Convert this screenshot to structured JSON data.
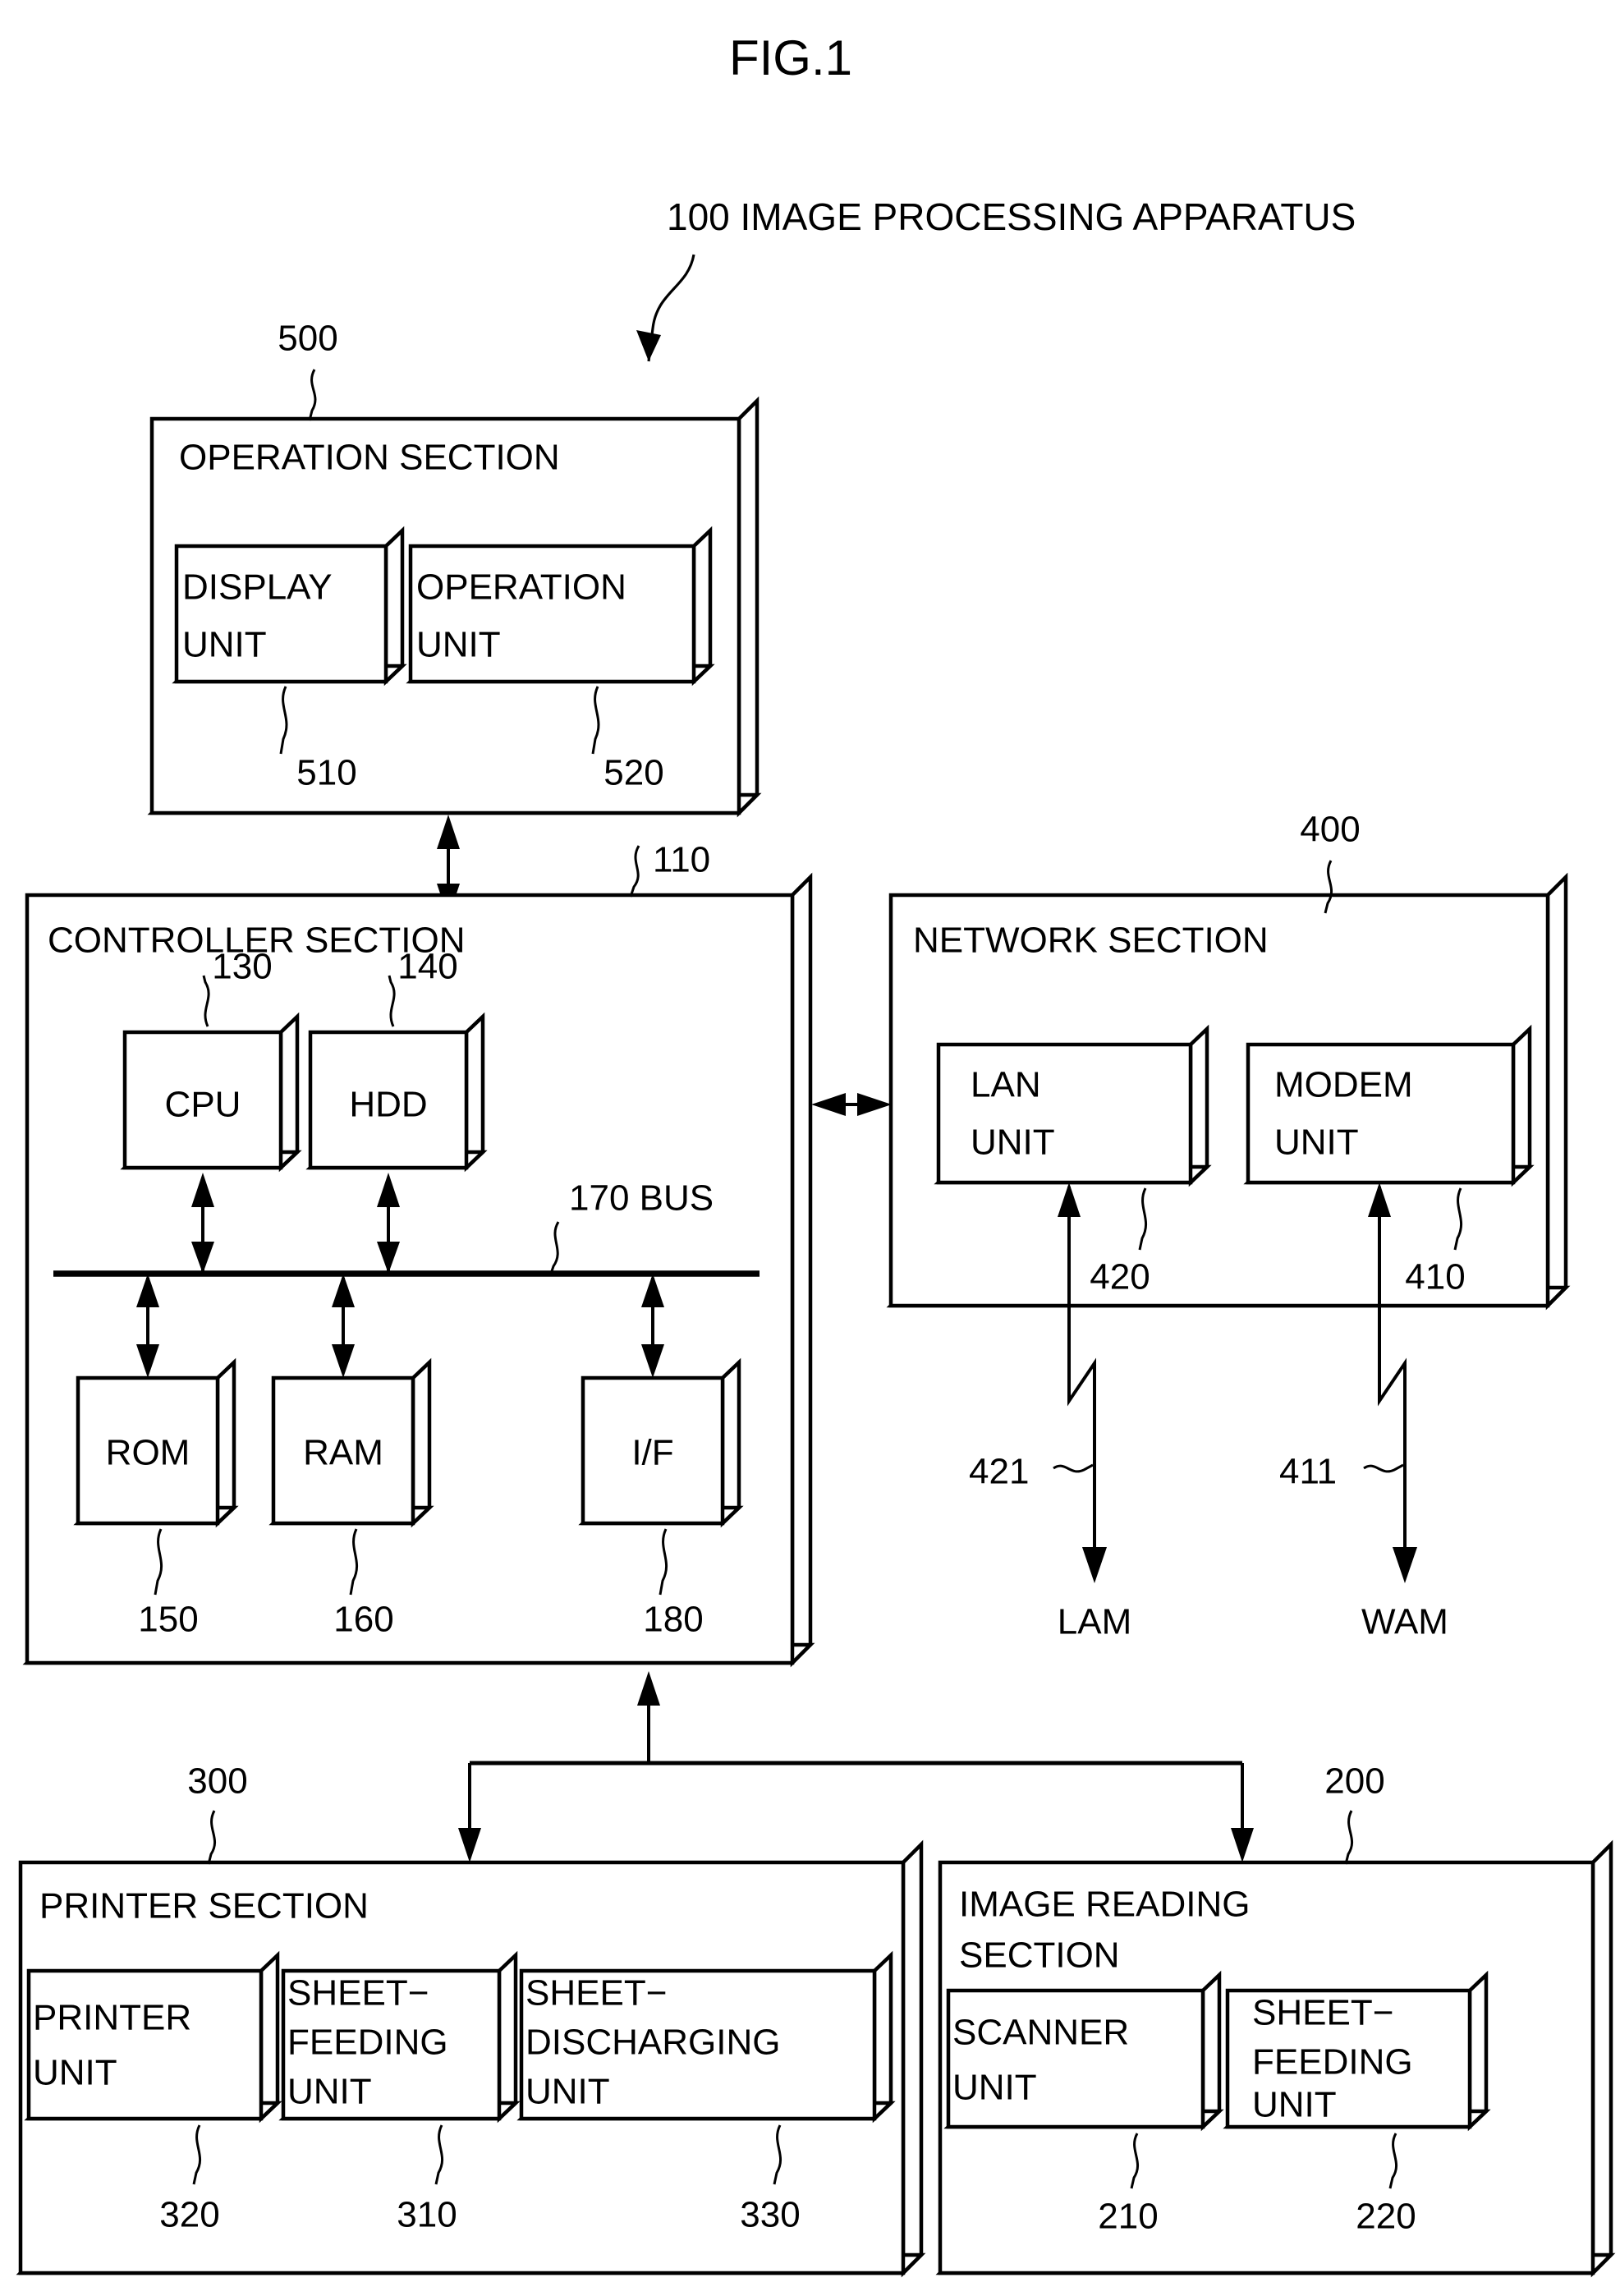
{
  "figure": {
    "title": "FIG.1",
    "callout": "100 IMAGE PROCESSING APPARATUS"
  },
  "sections": {
    "operation": {
      "ref": "500",
      "title": "OPERATION SECTION",
      "units": [
        {
          "ref": "510",
          "line1": "DISPLAY",
          "line2": "UNIT"
        },
        {
          "ref": "520",
          "line1": "OPERATION",
          "line2": "UNIT"
        }
      ]
    },
    "controller": {
      "ref": "110",
      "title": "CONTROLLER SECTION",
      "bus_label": "170 BUS",
      "top_units": [
        {
          "ref": "130",
          "label": "CPU"
        },
        {
          "ref": "140",
          "label": "HDD"
        }
      ],
      "bottom_units": [
        {
          "ref": "150",
          "label": "ROM"
        },
        {
          "ref": "160",
          "label": "RAM"
        },
        {
          "ref": "180",
          "label": "I/F"
        }
      ]
    },
    "network": {
      "ref": "400",
      "title": "NETWORK SECTION",
      "units": [
        {
          "ref": "420",
          "line1": "LAN",
          "line2": "UNIT",
          "link_ref": "421",
          "endpoint": "LAM"
        },
        {
          "ref": "410",
          "line1": "MODEM",
          "line2": "UNIT",
          "link_ref": "411",
          "endpoint": "WAM"
        }
      ]
    },
    "printer": {
      "ref": "300",
      "title": "PRINTER SECTION",
      "units": [
        {
          "ref": "320",
          "line1": "PRINTER",
          "line2": "UNIT",
          "line3": ""
        },
        {
          "ref": "310",
          "line1": "SHEET−",
          "line2": "FEEDING",
          "line3": "UNIT"
        },
        {
          "ref": "330",
          "line1": "SHEET−",
          "line2": "DISCHARGING",
          "line3": "UNIT"
        }
      ]
    },
    "image_reading": {
      "ref": "200",
      "title_line1": "IMAGE READING",
      "title_line2": "SECTION",
      "units": [
        {
          "ref": "210",
          "line1": "SCANNER",
          "line2": "UNIT",
          "line3": ""
        },
        {
          "ref": "220",
          "line1": "SHEET−",
          "line2": "FEEDING",
          "line3": "UNIT"
        }
      ]
    }
  },
  "colors": {
    "ink": "#000000",
    "paper": "#ffffff"
  }
}
